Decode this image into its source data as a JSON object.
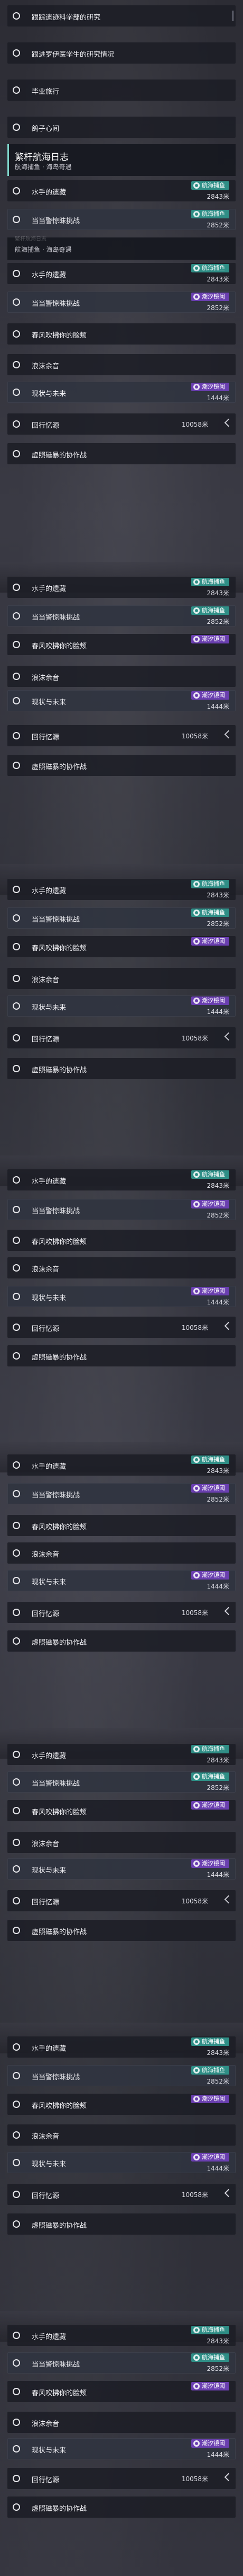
{
  "strings": {
    "t_a": "跟踪遗迹科学部的研究",
    "t_b": "跟进罗伊医学生的研究情况",
    "t_c": "毕业旅行",
    "t_d": "鸽子心间",
    "t_water": "水手的遗藏",
    "t_ghost": "当当警惊眛挑战",
    "t_spring": "春风吹拂你的脸颊",
    "t_waves": "浪沫余音",
    "t_now": "现状与未来",
    "t_look": "回行忆源",
    "t_storm": "虚照磁暴的协作战"
  },
  "header": {
    "title": "繁杆航海日志",
    "subtitle": "航海捕鱼 · 海岛奇遇",
    "faint": "繁杆航海日志"
  },
  "badges": {
    "nav": "航海捕鱼",
    "tide": "潮汐镜阈"
  },
  "dist": {
    "d2843": "2843米",
    "d2852": "2852米",
    "d1444": "1444米",
    "d10058": "10058米"
  },
  "colors": {
    "nav_badge": "#2f8e86",
    "tide_badge": "#6a3fb0"
  }
}
